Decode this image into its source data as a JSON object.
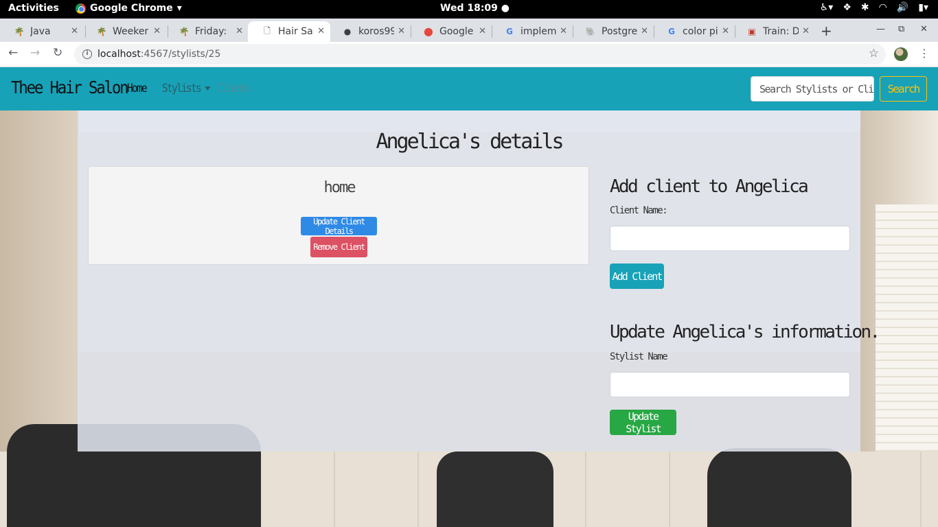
{
  "gnome": {
    "activities": "Activities",
    "app_name": "Google Chrome",
    "clock": "Wed 18:09 ●"
  },
  "tabs": [
    {
      "title": "Java",
      "icon": "tree-icon"
    },
    {
      "title": "Weekend",
      "icon": "tree-icon"
    },
    {
      "title": "Friday: I",
      "icon": "tree-icon"
    },
    {
      "title": "Hair Sal",
      "icon": "page-icon"
    },
    {
      "title": "koros99",
      "icon": "github-icon"
    },
    {
      "title": "Google",
      "icon": "firebase-icon"
    },
    {
      "title": "implem",
      "icon": "google-icon"
    },
    {
      "title": "Postgre",
      "icon": "postgres-icon"
    },
    {
      "title": "color pi",
      "icon": "google-icon"
    },
    {
      "title": "Train: D",
      "icon": "train-icon"
    }
  ],
  "address": {
    "host": "localhost",
    "path": ":4567/stylists/25"
  },
  "navbar": {
    "brand": "Thee Hair Salon",
    "home": "Home",
    "stylists": "Stylists",
    "clients": "Clients",
    "search_placeholder": "Search Stylists or Clients",
    "search_button": "Search"
  },
  "details": {
    "title": "Angelica's details",
    "client_name": "home",
    "update_client_button": "Update Client Details",
    "remove_client_button": "Remove Client"
  },
  "add_client": {
    "heading": "Add client to Angelica",
    "label": "Client Name:",
    "button": "Add Client"
  },
  "update_stylist": {
    "heading": "Update Angelica's information.",
    "label": "Stylist Name",
    "button": "Update Stylist"
  },
  "colors": {
    "navbar": "#17a2b8",
    "search_button": "#ffc107",
    "update_client": "#2f8ae6",
    "remove_client": "#dc5163",
    "add_client": "#17a2b8",
    "update_stylist": "#28a745"
  }
}
